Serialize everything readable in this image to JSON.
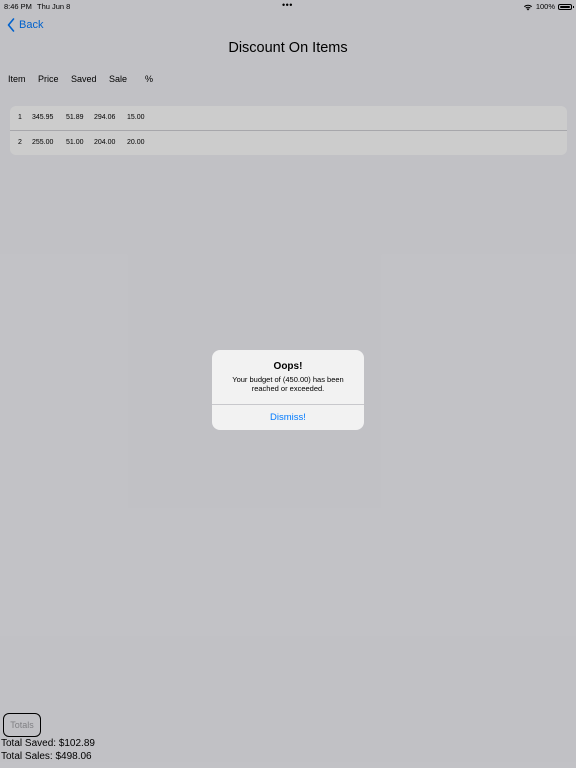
{
  "status_bar": {
    "time": "8:46 PM",
    "date": "Thu Jun 8",
    "dots": "•••",
    "battery": "100%"
  },
  "nav": {
    "back_label": "Back",
    "title": "Discount On Items"
  },
  "table": {
    "headers": [
      "Item",
      "Price",
      "Saved",
      "Sale",
      "%"
    ],
    "rows": [
      {
        "item": "1",
        "price": "345.95",
        "saved": "51.89",
        "sale": "294.06",
        "pct": "15.00"
      },
      {
        "item": "2",
        "price": "255.00",
        "saved": "51.00",
        "sale": "204.00",
        "pct": "20.00"
      }
    ]
  },
  "footer": {
    "totals_label": "Totals",
    "total_saved": "Total Saved: $102.89",
    "total_sales": "Total Sales: $498.06"
  },
  "alert": {
    "title": "Oops!",
    "message": "Your budget of (450.00) has been reached or exceeded.",
    "dismiss_label": "Dismiss!"
  },
  "colors": {
    "accent": "#007aff",
    "background": "#f2f2f7",
    "overlay": "rgba(0,0,0,0.2)"
  }
}
